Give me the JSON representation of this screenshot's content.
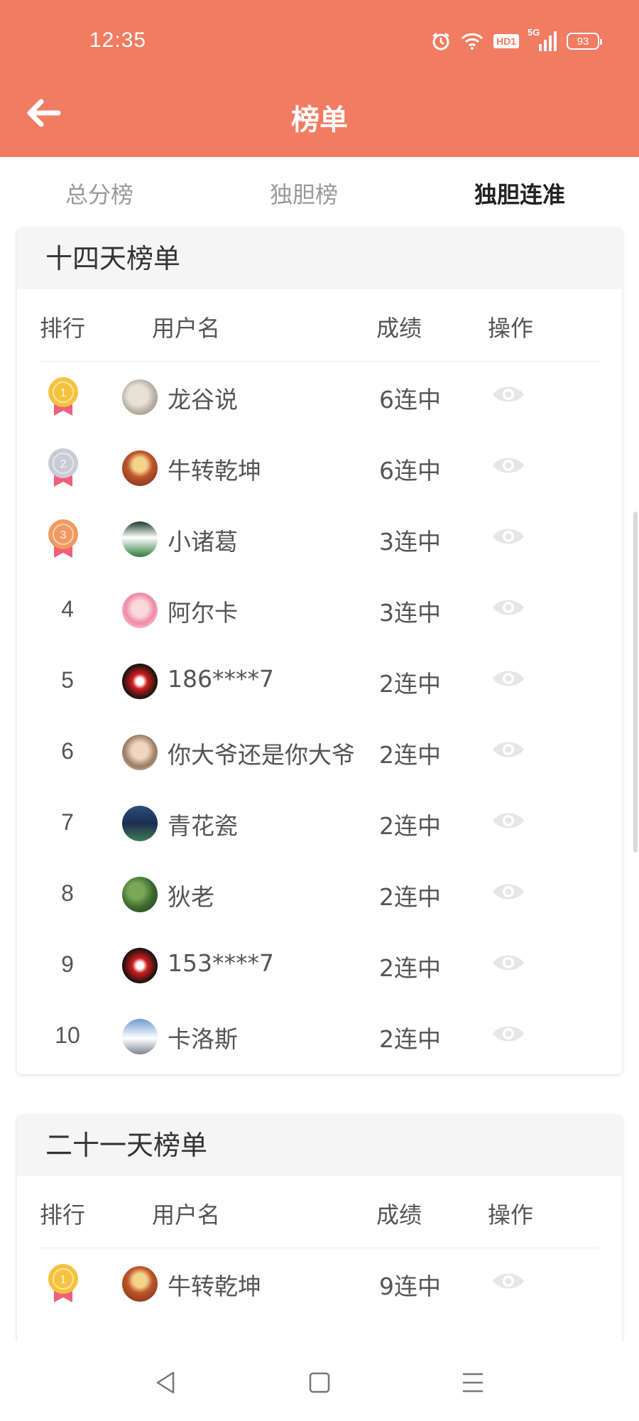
{
  "status_bar": {
    "time": "12:35",
    "hd_label": "HD1",
    "network": "5G",
    "battery": "93"
  },
  "header": {
    "title": "榜单"
  },
  "tabs": [
    {
      "label": "总分榜",
      "active": false
    },
    {
      "label": "独胆榜",
      "active": false
    },
    {
      "label": "独胆连准",
      "active": true
    }
  ],
  "columns": {
    "rank": "排行",
    "user": "用户名",
    "score": "成绩",
    "action": "操作"
  },
  "boards": [
    {
      "title": "十四天榜单",
      "rows": [
        {
          "rank": "1",
          "medal": "gold",
          "avatar": "cat-photo",
          "name": "龙谷说",
          "score": "6连中"
        },
        {
          "rank": "2",
          "medal": "silver",
          "avatar": "illustrated-character",
          "name": "牛转乾坤",
          "score": "6连中"
        },
        {
          "rank": "3",
          "medal": "bronze",
          "avatar": "soccer-player",
          "name": "小诸葛",
          "score": "3连中"
        },
        {
          "rank": "4",
          "medal": "",
          "avatar": "anime-girl",
          "name": "阿尔卡",
          "score": "3连中"
        },
        {
          "rank": "5",
          "medal": "",
          "avatar": "red-black-logo",
          "name": "186****7",
          "score": "2连中"
        },
        {
          "rank": "6",
          "medal": "",
          "avatar": "portrait-photo",
          "name": "你大爷还是你大爷",
          "score": "2连中"
        },
        {
          "rank": "7",
          "medal": "",
          "avatar": "drink-cup",
          "name": "青花瓷",
          "score": "2连中"
        },
        {
          "rank": "8",
          "medal": "",
          "avatar": "plant-photo",
          "name": "狄老",
          "score": "2连中"
        },
        {
          "rank": "9",
          "medal": "",
          "avatar": "red-black-logo",
          "name": "153****7",
          "score": "2连中"
        },
        {
          "rank": "10",
          "medal": "",
          "avatar": "snow-mountain",
          "name": "卡洛斯",
          "score": "2连中"
        }
      ]
    },
    {
      "title": "二十一天榜单",
      "rows": [
        {
          "rank": "1",
          "medal": "gold",
          "avatar": "illustrated-character",
          "name": "牛转乾坤",
          "score": "9连中"
        }
      ]
    }
  ],
  "colors": {
    "accent": "#f17c62",
    "gold": "#f6c23e",
    "silver": "#c9cbd6",
    "bronze": "#ef9a63",
    "ribbon": "#f0607a"
  },
  "icons": {
    "back": "arrow-left-icon",
    "eye": "eye-icon",
    "alarm": "alarm-icon",
    "wifi": "wifi-icon",
    "signal": "signal-icon",
    "battery": "battery-icon",
    "nav_back": "triangle-back-icon",
    "nav_home": "square-home-icon",
    "nav_menu": "menu-lines-icon"
  }
}
